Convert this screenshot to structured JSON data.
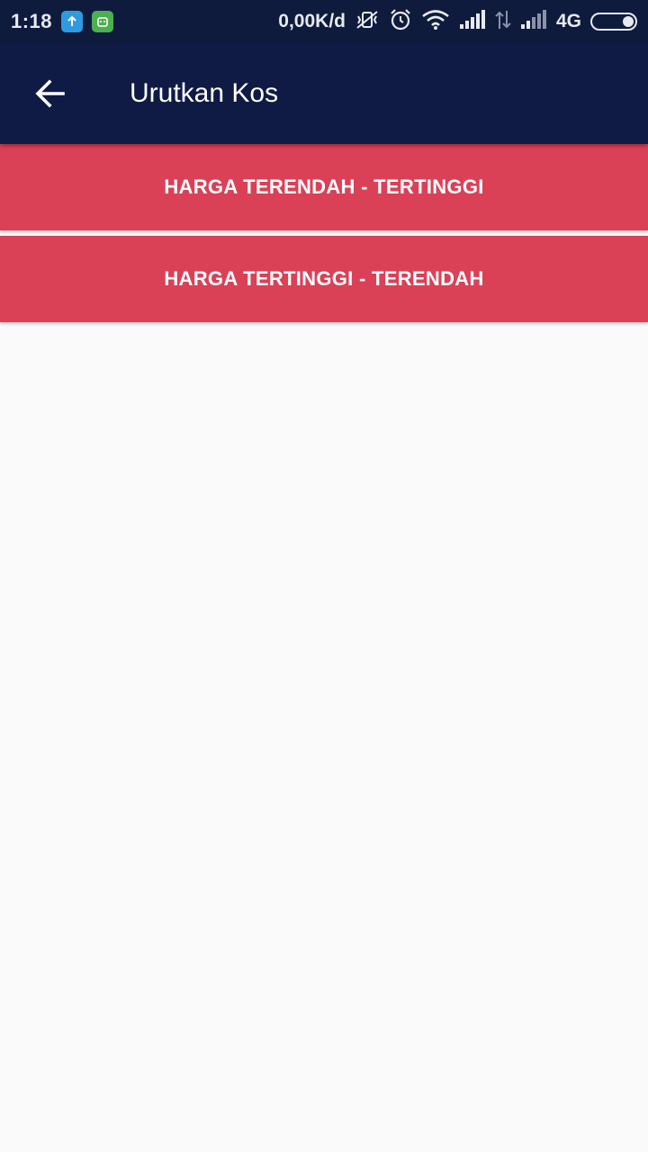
{
  "status_bar": {
    "time": "1:18",
    "net_speed": "0,00K/d",
    "network_type": "4G",
    "icons": [
      "upload-icon",
      "android-icon",
      "mute-vibrate-icon",
      "alarm-icon",
      "wifi-icon",
      "signal-icon",
      "data-arrows-icon",
      "signal-icon",
      "battery-icon"
    ]
  },
  "app_bar": {
    "title": "Urutkan Kos",
    "back_icon": "arrow-back-icon"
  },
  "sort_options": [
    {
      "label": "HARGA TERENDAH - TERTINGGI"
    },
    {
      "label": "HARGA TERTINGGI - TERENDAH"
    }
  ],
  "colors": {
    "status_bar_bg": "#0f1b3d",
    "app_bar_bg": "#0f1b45",
    "button_bg": "#da4157",
    "page_bg": "#fafafa"
  }
}
